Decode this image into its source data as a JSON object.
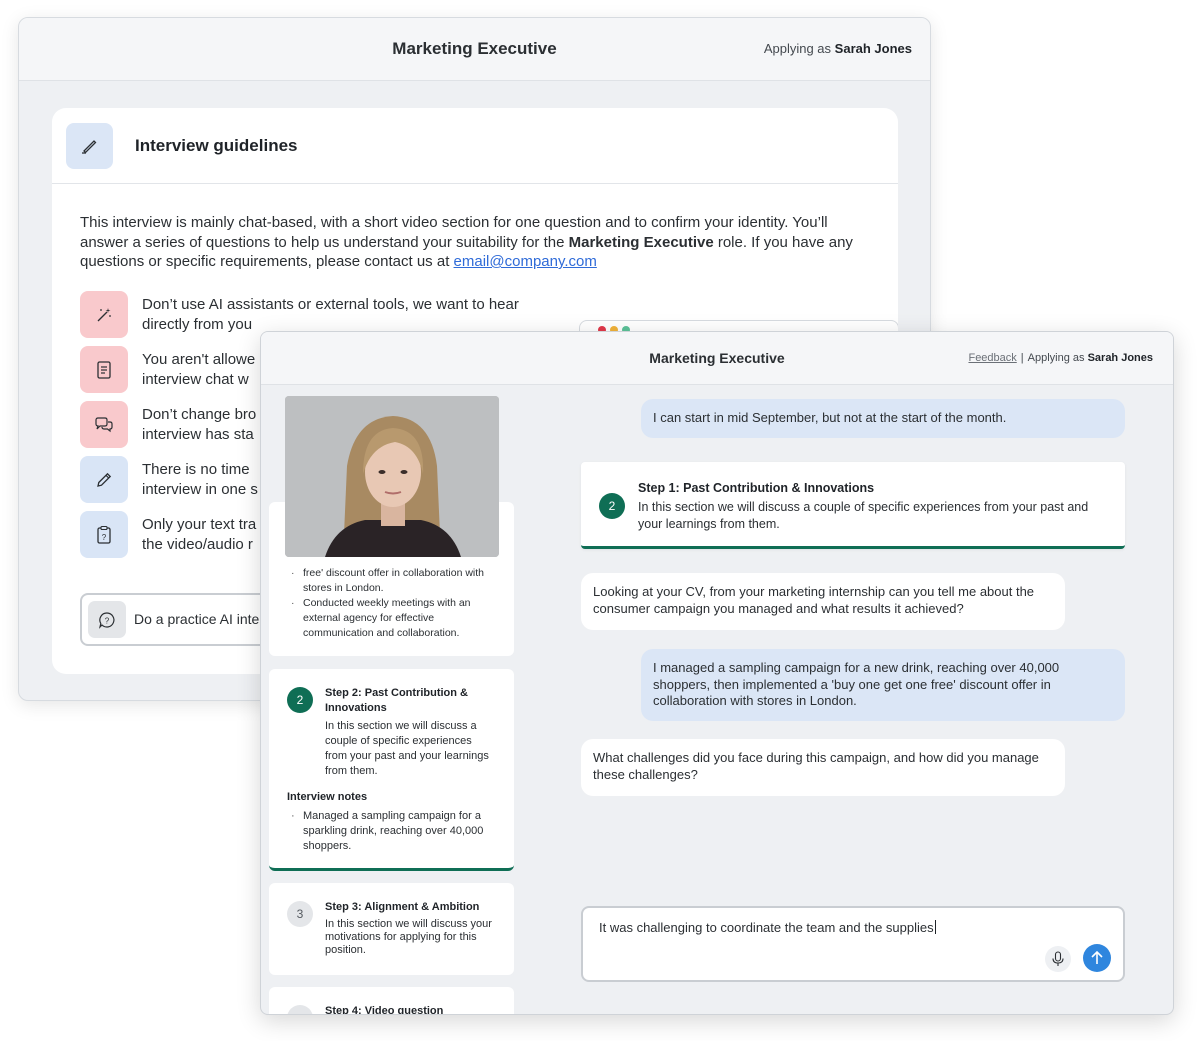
{
  "back_window": {
    "title": "Marketing Executive",
    "applying_prefix": "Applying as",
    "applicant_name": "Sarah Jones",
    "guidelines": {
      "icon": "pen-icon",
      "title": "Interview guidelines",
      "intro_part1": "This interview is mainly chat-based, with a short video section for one question and to confirm your identity. You’ll answer a series of questions to help us understand your suitability for the ",
      "intro_role": "Marketing Executive",
      "intro_part2": " role. If you have any questions or specific requirements, please contact us at ",
      "intro_email": "email@company.com",
      "rules": [
        {
          "icon": "magic-wand-icon",
          "text": "Don’t use AI assistants or external tools, we want to hear directly from you"
        },
        {
          "icon": "document-icon",
          "text": "You aren't allowe"
        },
        {
          "icon": "chat-bubbles-icon",
          "text": "Don’t change bro"
        },
        {
          "icon": "pencil-icon",
          "text": "There is no time"
        },
        {
          "icon": "clipboard-question-icon",
          "text": "Only your text tra"
        }
      ],
      "rules_line2": [
        "hear directly from you",
        "interview chat w",
        "interview has sta",
        "interview in one s",
        "the video/audio r"
      ],
      "practice_label": "Do a practice AI inte"
    }
  },
  "front_window": {
    "title": "Marketing Executive",
    "feedback_link": "Feedback",
    "separator": "|",
    "applying_prefix": "Applying as",
    "applicant_name": "Sarah Jones",
    "sidebar": {
      "step1_bullets": [
        "free' discount offer in collaboration with  stores in London.",
        "Conducted weekly meetings with an external agency for effective communication and collaboration."
      ],
      "step2": {
        "number": "2",
        "title": "Step 2: Past Contribution & Innovations",
        "description": "In this section we will discuss a couple of specific experiences from your past and your learnings from them.",
        "notes_label": "Interview notes",
        "notes": [
          "Managed a sampling campaign for a sparkling drink, reaching over 40,000 shoppers."
        ]
      },
      "step3": {
        "number": "3",
        "title": "Step 3: Alignment & Ambition",
        "description": "In this section we will discuss your motivations for applying for this position."
      },
      "step4": {
        "title": "Step 4: Video question"
      }
    },
    "chat": {
      "msg1": "I can start in mid September, but not at the start of the month.",
      "step_banner": {
        "number": "2",
        "title": "Step 1: Past Contribution & Innovations",
        "description": "In this section we will discuss a couple of specific experiences from your past and your learnings from them."
      },
      "msg2": "Looking at your CV, from your marketing internship can you tell me about the consumer campaign you managed and what results it achieved?",
      "msg3": "I managed a sampling campaign for a new drink, reaching over 40,000 shoppers, then implemented a 'buy one get one free' discount offer in collaboration with stores in London.",
      "msg4": "What challenges did you face during this campaign, and how did you manage these challenges?",
      "composer_value": "It was challenging to coordinate the team and the supplies"
    }
  },
  "colors": {
    "accent_green": "#0f6e55",
    "user_bubble": "#dbe6f6",
    "send_blue": "#2f86de",
    "rule_red": "#f9c9cc",
    "rule_blue": "#d9e5f6"
  }
}
